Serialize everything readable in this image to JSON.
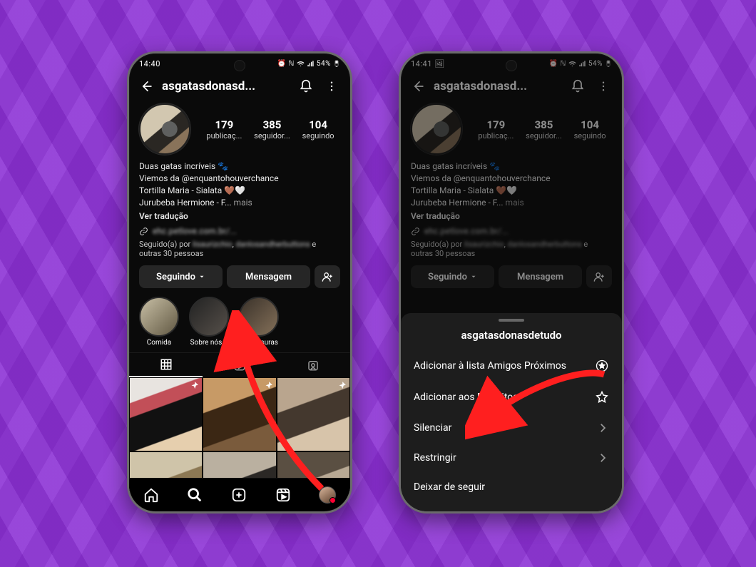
{
  "colors": {
    "bg": "#8e3bd6",
    "arrow": "#ff1f1f"
  },
  "status": {
    "time_left": "14:40",
    "time_right": "14:41",
    "battery": "54%",
    "extra": "☼"
  },
  "header": {
    "username_trunc": "asgatasdonasd..."
  },
  "sheet_title": "asgatasdonasdetudo",
  "stats": {
    "posts": {
      "n": "179",
      "label": "publicaç..."
    },
    "followers": {
      "n": "385",
      "label": "seguidor..."
    },
    "following": {
      "n": "104",
      "label": "seguindo"
    }
  },
  "bio": {
    "line1": "Duas gatas incríveis 🐾",
    "line2": "Viemos da @enquantohouverchance",
    "line3": "Tortilla Maria - Sialata 🤎🤍",
    "line4_pre": "Jurubeba Hermione - F...",
    "more": " mais",
    "translate": "Ver tradução",
    "link_text": "ehc.petlove.com.br/..."
  },
  "followed": {
    "prefix": "Seguido(a) por ",
    "b1": "lisaurizchio",
    "b2": "danlosandherbuttons",
    "suffix_e": " e",
    "line2": "outras 30 pessoas"
  },
  "buttons": {
    "following": "Seguindo",
    "message": "Mensagem"
  },
  "highlights": [
    {
      "label": "Comida"
    },
    {
      "label": "Sobre nós 2"
    },
    {
      "label": "Travessuras"
    }
  ],
  "sheet": {
    "close_friends": "Adicionar à lista Amigos Próximos",
    "favorites": "Adicionar aos Favoritos",
    "mute": "Silenciar",
    "restrict": "Restringir",
    "unfollow": "Deixar de seguir"
  }
}
